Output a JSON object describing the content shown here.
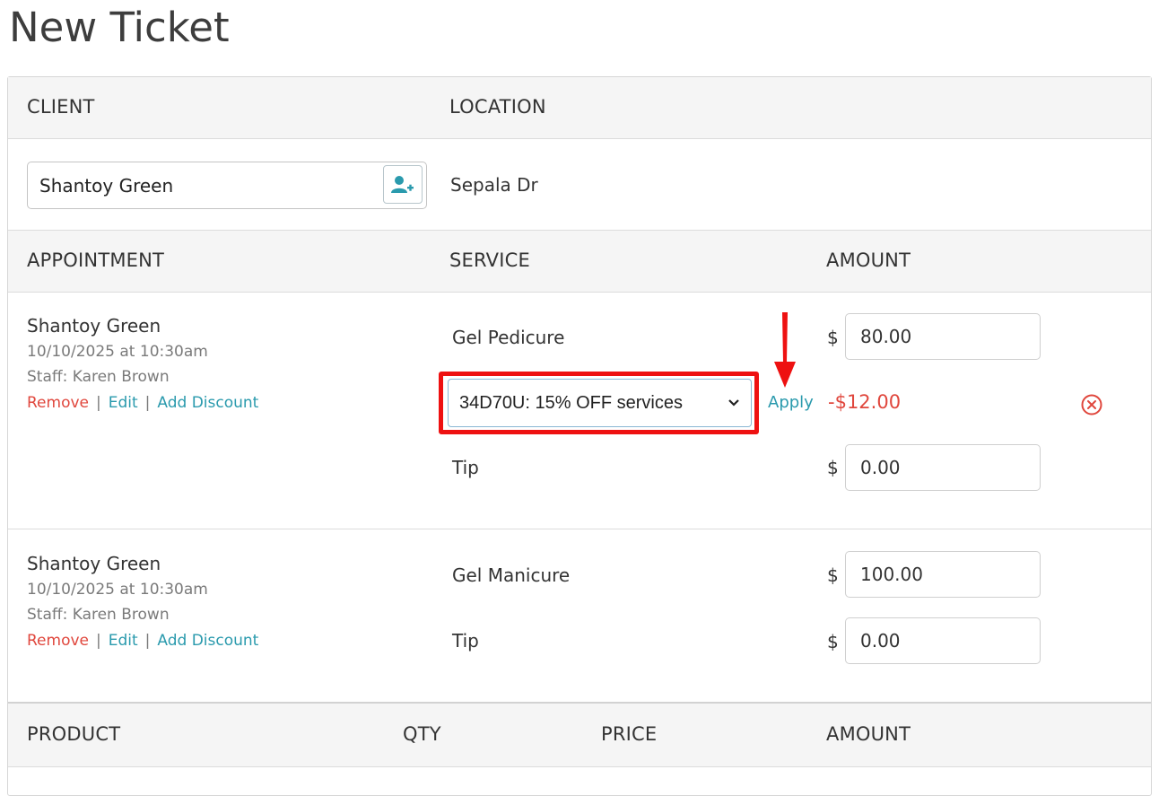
{
  "page": {
    "title": "New Ticket"
  },
  "client_section": {
    "client_header": "CLIENT",
    "location_header": "LOCATION",
    "client_value": "Shantoy Green",
    "location_value": "Sepala Dr"
  },
  "appointments_header": {
    "appointment": "APPOINTMENT",
    "service": "SERVICE",
    "amount": "AMOUNT"
  },
  "appointments": [
    {
      "client_name": "Shantoy Green",
      "datetime": "10/10/2025 at 10:30am",
      "staff": "Staff: Karen Brown",
      "remove": "Remove",
      "edit": "Edit",
      "add_discount": "Add Discount",
      "sep": "|",
      "service": "Gel Pedicure",
      "currency": "$",
      "amount": "80.00",
      "discount_selected": "34D70U: 15% OFF services",
      "apply": "Apply",
      "discount_amount": "-$12.00",
      "tip_label": "Tip",
      "tip": "0.00"
    },
    {
      "client_name": "Shantoy Green",
      "datetime": "10/10/2025 at 10:30am",
      "staff": "Staff: Karen Brown",
      "remove": "Remove",
      "edit": "Edit",
      "add_discount": "Add Discount",
      "sep": "|",
      "service": "Gel Manicure",
      "currency": "$",
      "amount": "100.00",
      "tip_label": "Tip",
      "tip": "0.00"
    }
  ],
  "products_header": {
    "product": "PRODUCT",
    "qty": "QTY",
    "price": "PRICE",
    "amount": "AMOUNT"
  },
  "colors": {
    "remove": "#e0473d",
    "link": "#2a9aad",
    "discount": "#e0473d",
    "annotation": "#ee1111"
  },
  "icons": {
    "add_client": "add-user-icon",
    "remove_discount": "circle-x-icon",
    "select": "chevron-down-icon",
    "annotation": "red-arrow-icon"
  }
}
